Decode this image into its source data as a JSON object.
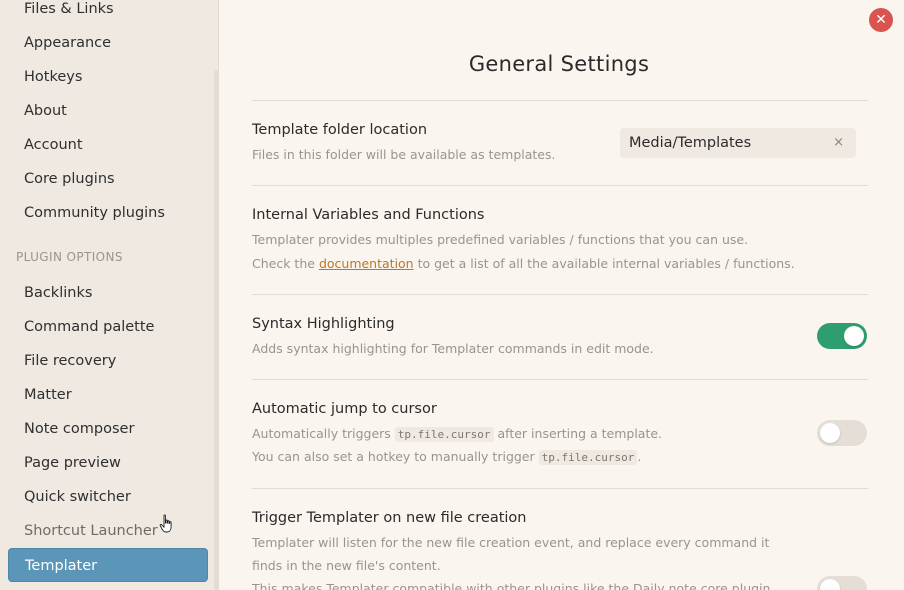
{
  "sidebar": {
    "items": [
      {
        "label": "Files & Links"
      },
      {
        "label": "Appearance"
      },
      {
        "label": "Hotkeys"
      },
      {
        "label": "About"
      },
      {
        "label": "Account"
      },
      {
        "label": "Core plugins"
      },
      {
        "label": "Community plugins"
      }
    ],
    "section_header": "PLUGIN OPTIONS",
    "plugin_items": [
      {
        "label": "Backlinks"
      },
      {
        "label": "Command palette"
      },
      {
        "label": "File recovery"
      },
      {
        "label": "Matter"
      },
      {
        "label": "Note composer"
      },
      {
        "label": "Page preview"
      },
      {
        "label": "Quick switcher"
      },
      {
        "label": "Shortcut Launcher"
      },
      {
        "label": "Templater"
      }
    ],
    "active_item": "Templater"
  },
  "main": {
    "title": "General Settings",
    "close_icon": "close-icon",
    "settings": {
      "template_folder": {
        "name": "Template folder location",
        "desc": "Files in this folder will be available as templates.",
        "value": "Media/Templates",
        "clear_glyph": "×"
      },
      "internal_vars": {
        "name": "Internal Variables and Functions",
        "desc1": "Templater provides multiples predefined variables / functions that you can use.",
        "desc2_before": "Check the",
        "desc2_link": "documentation",
        "desc2_after": "to get a list of all the available internal variables / functions."
      },
      "syntax_highlighting": {
        "name": "Syntax Highlighting",
        "desc": "Adds syntax highlighting for Templater commands in edit mode.",
        "enabled": true
      },
      "auto_jump": {
        "name": "Automatic jump to cursor",
        "desc1_before": "Automatically triggers",
        "desc1_code": "tp.file.cursor",
        "desc1_after": "after inserting a template.",
        "desc2_before": "You can also set a hotkey to manually trigger",
        "desc2_code": "tp.file.cursor",
        "desc2_after": ".",
        "enabled": false
      },
      "trigger_on_create": {
        "name": "Trigger Templater on new file creation",
        "desc1": "Templater will listen for the new file creation event, and replace every command it",
        "desc2": "finds in the new file's content.",
        "desc3": "This makes Templater compatible with other plugins like the Daily note core plugin,",
        "enabled": false
      }
    }
  },
  "colors": {
    "accent_active": "#5b96b8",
    "toggle_on": "#2f9e6e",
    "close": "#d9534f",
    "link": "#b9772a"
  }
}
